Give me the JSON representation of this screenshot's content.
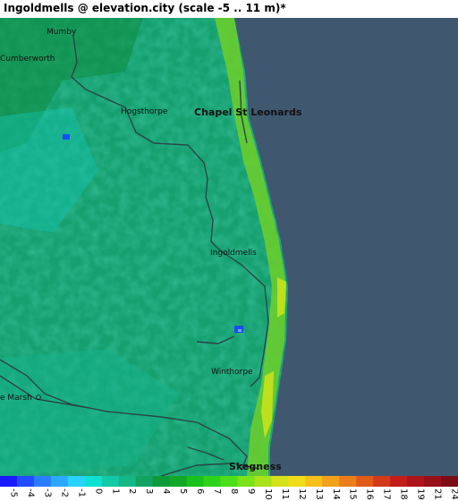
{
  "title": "Ingoldmells @ elevation.city (scale -5 .. 11 m)*",
  "colors": {
    "sea": "#3f5870",
    "land_base": "#1a9e6f",
    "land_dark": "#0f8a55",
    "land_light": "#22b88a",
    "coast_bright": "#7fd31f",
    "coast_yellow": "#c8e21a",
    "road": "#2c4a4a",
    "water_blue": "#1b4cff"
  },
  "places": [
    {
      "name": "Mumby",
      "size": "small"
    },
    {
      "name": "Cumberworth",
      "size": "small"
    },
    {
      "name": "Hogsthorpe",
      "size": "small"
    },
    {
      "name": "Chapel St Leonards",
      "size": "large"
    },
    {
      "name": "Ingoldmells",
      "size": "small"
    },
    {
      "name": "Winthorpe",
      "size": "small"
    },
    {
      "name": "e Marsh",
      "size": "small"
    },
    {
      "name": "Skegness",
      "size": "large"
    }
  ],
  "legend": {
    "labels": [
      "-5",
      "-4",
      "-3",
      "-2",
      "-1",
      "0",
      "1",
      "2",
      "3",
      "4",
      "5",
      "6",
      "7",
      "8",
      "9",
      "10",
      "11",
      "12",
      "13",
      "14",
      "15",
      "16",
      "17",
      "18",
      "19",
      "21",
      "24"
    ],
    "colors": [
      "#1a1aff",
      "#1f4dff",
      "#2a7dff",
      "#2ea8ff",
      "#28d4ff",
      "#10e0d0",
      "#12c9a8",
      "#14b786",
      "#12a363",
      "#0f9a3a",
      "#11a82a",
      "#18c21a",
      "#2fd31a",
      "#4ddf1a",
      "#7ce21a",
      "#a8e21a",
      "#d4e21a",
      "#f1dc1a",
      "#f5c01a",
      "#f2a11a",
      "#ec7e1a",
      "#e05a1a",
      "#d23a1a",
      "#c21f1a",
      "#ac141a",
      "#96101a",
      "#7c0c16"
    ]
  }
}
